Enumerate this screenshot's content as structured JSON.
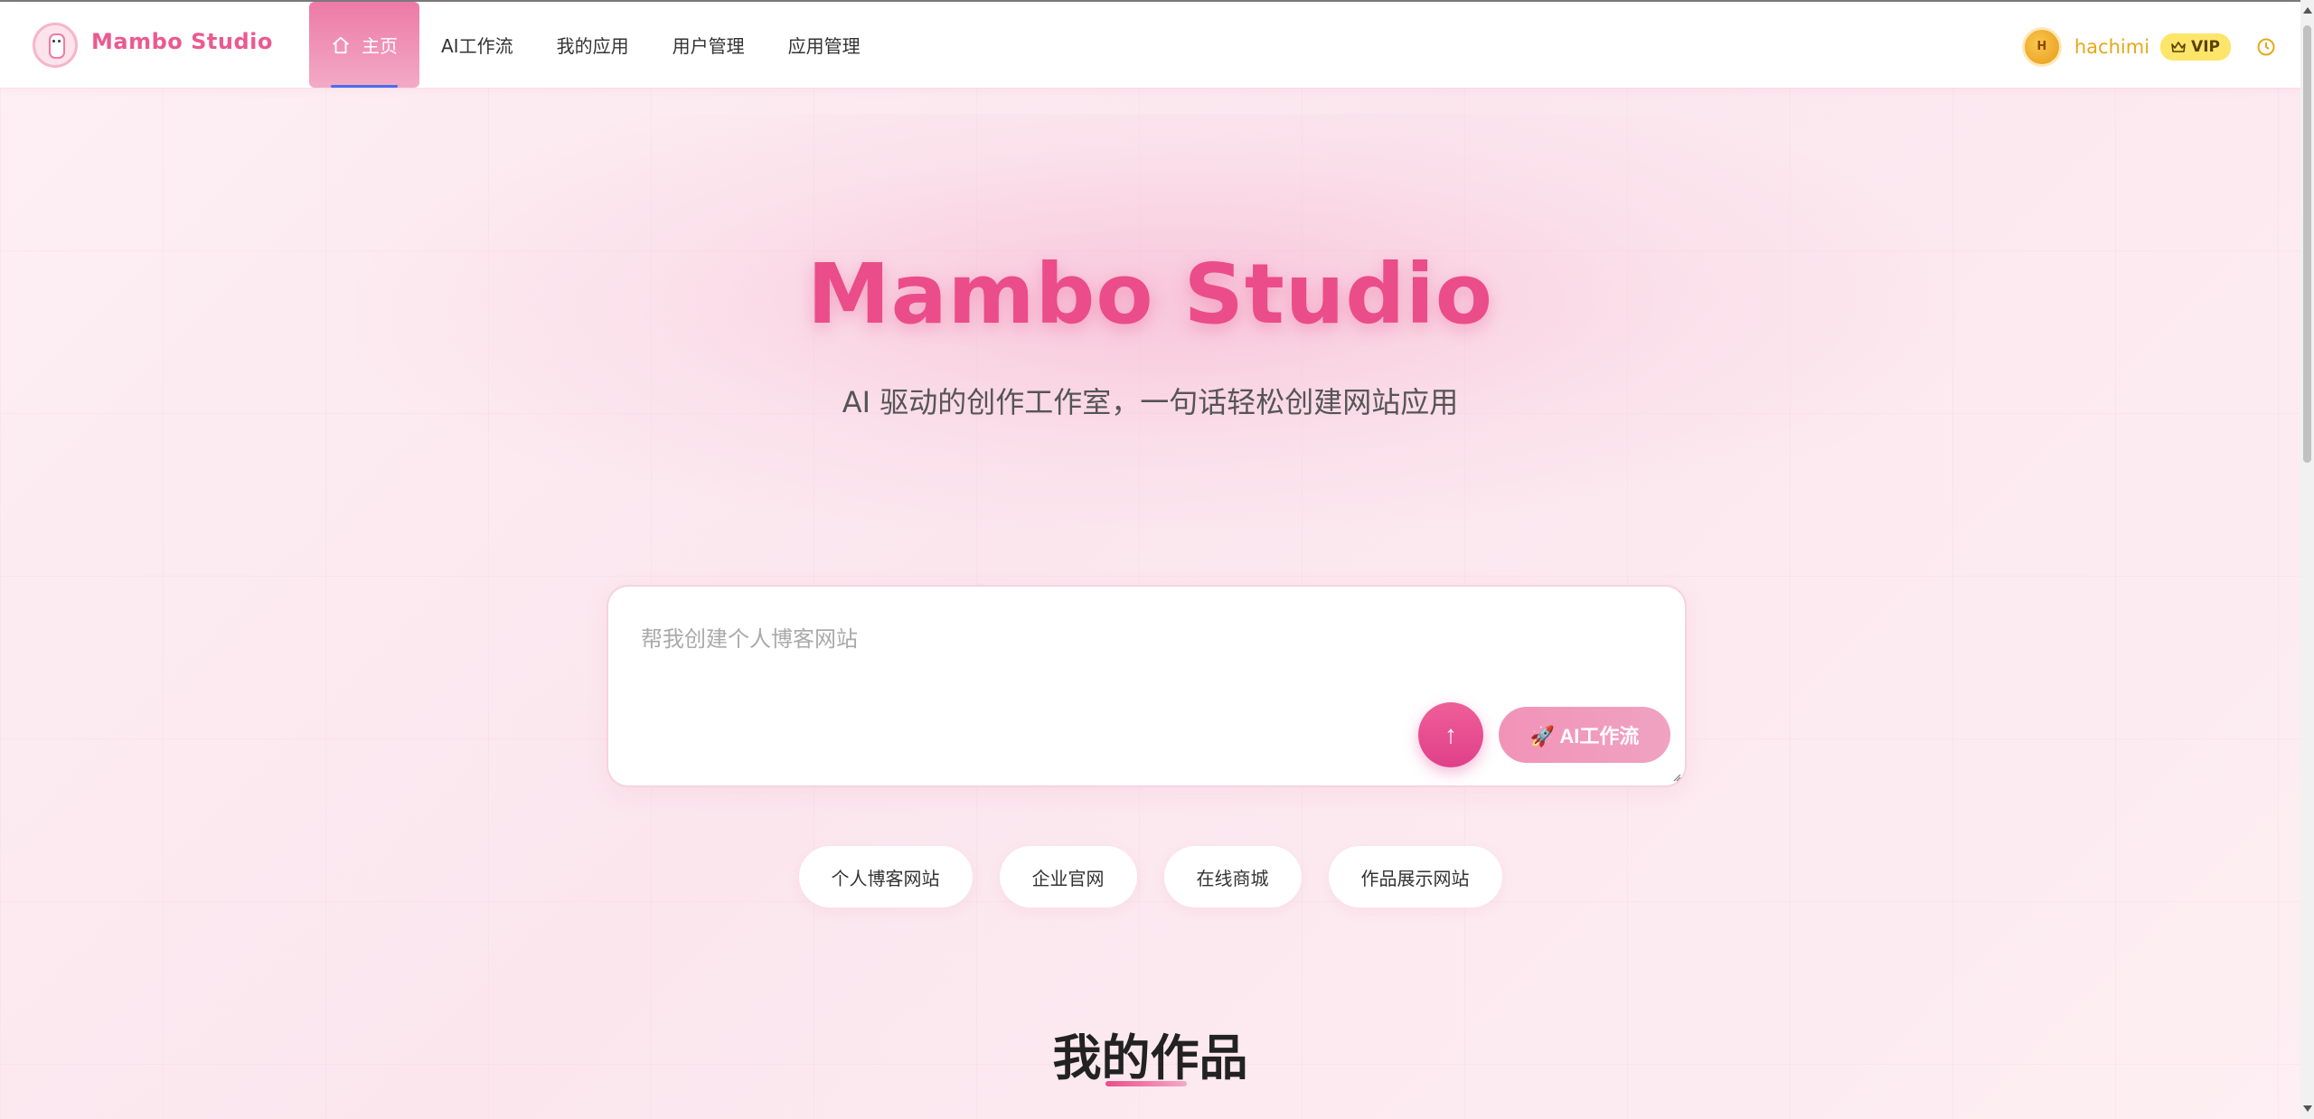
{
  "header": {
    "brand": "Mambo Studio",
    "nav": [
      {
        "label": "主页",
        "icon": "home-icon",
        "active": true
      },
      {
        "label": "AI工作流"
      },
      {
        "label": "我的应用"
      },
      {
        "label": "用户管理"
      },
      {
        "label": "应用管理"
      }
    ],
    "user": {
      "name": "hachimi",
      "avatar_letter": "H",
      "badge": "VIP"
    }
  },
  "hero": {
    "title": "Mambo Studio",
    "subtitle": "AI 驱动的创作工作室，一句话轻松创建网站应用"
  },
  "prompt": {
    "placeholder": "帮我创建个人博客网站",
    "send_label": "↑",
    "workflow_label": "🚀 AI工作流"
  },
  "suggestions": [
    "个人博客网站",
    "企业官网",
    "在线商城",
    "作品展示网站"
  ],
  "section": {
    "title": "我的作品"
  },
  "colors": {
    "accent": "#ea4d89",
    "vip": "#fde56a",
    "username": "#e6a817"
  }
}
